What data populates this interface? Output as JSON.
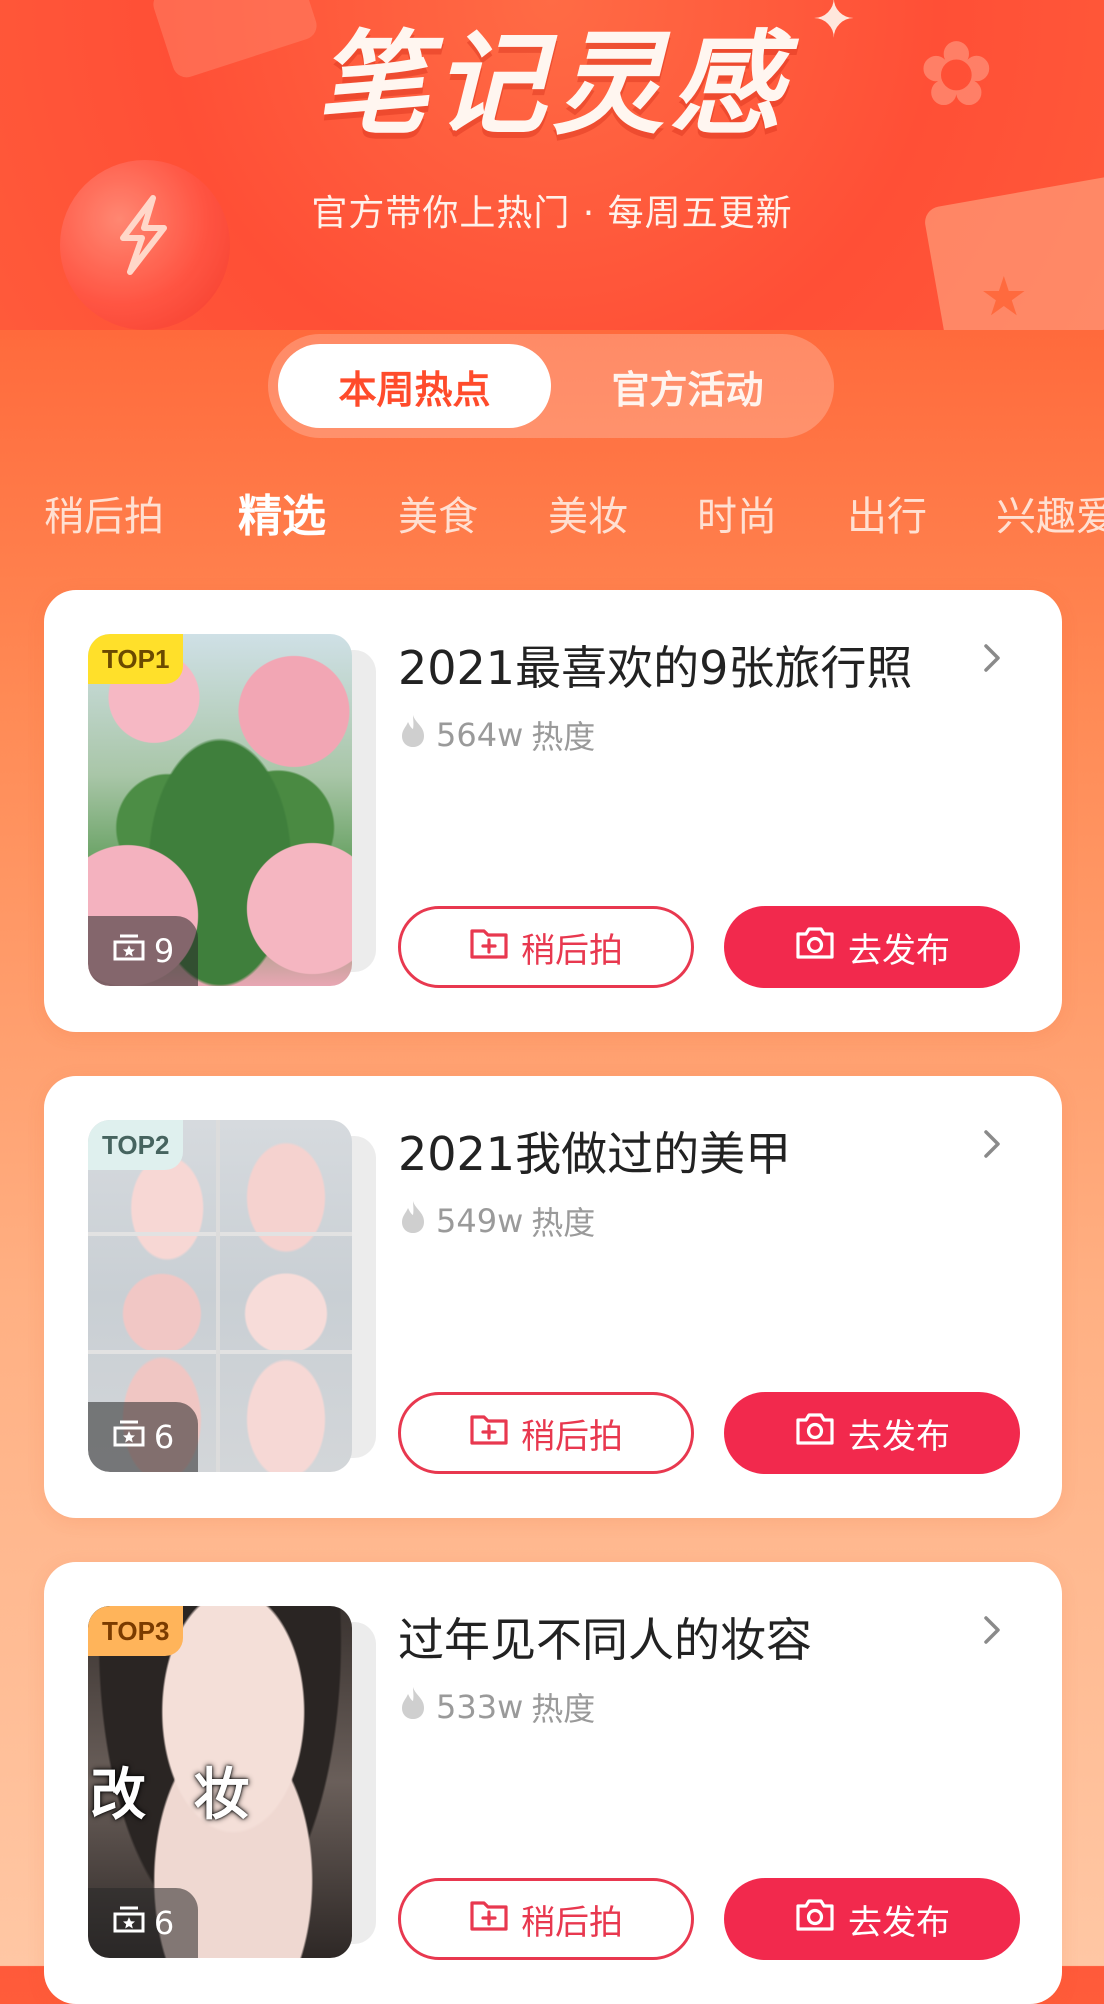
{
  "banner": {
    "title": "笔记灵感",
    "subtitle": "官方带你上热门 · 每周五更新"
  },
  "toggle": {
    "tabs": [
      "本周热点",
      "官方活动"
    ],
    "active_index": 0
  },
  "categories": {
    "items": [
      "稍后拍",
      "精选",
      "美食",
      "美妆",
      "时尚",
      "出行",
      "兴趣爱"
    ],
    "active_index": 1
  },
  "cards": [
    {
      "rank": "TOP1",
      "title": "2021最喜欢的9张旅行照",
      "heat_value": "564w",
      "heat_label": "热度",
      "image_count": "9",
      "later_label": "稍后拍",
      "publish_label": "去发布"
    },
    {
      "rank": "TOP2",
      "title": "2021我做过的美甲",
      "heat_value": "549w",
      "heat_label": "热度",
      "image_count": "6",
      "later_label": "稍后拍",
      "publish_label": "去发布"
    },
    {
      "rank": "TOP3",
      "title": "过年见不同人的妆容",
      "heat_value": "533w",
      "heat_label": "热度",
      "image_count": "6",
      "later_label": "稍后拍",
      "publish_label": "去发布",
      "image_overlay_text": "改 妆"
    }
  ],
  "colors": {
    "accent": "#f2294d",
    "banner": "#ff5a3a",
    "badge_top1": "#ffe02a",
    "badge_top2": "#dff0ee",
    "badge_top3": "#ffb45a"
  },
  "icons": {
    "chevron": "chevron-right-icon",
    "heat": "flame-icon",
    "later": "add-folder-icon",
    "publish": "camera-icon",
    "count": "gallery-icon"
  }
}
